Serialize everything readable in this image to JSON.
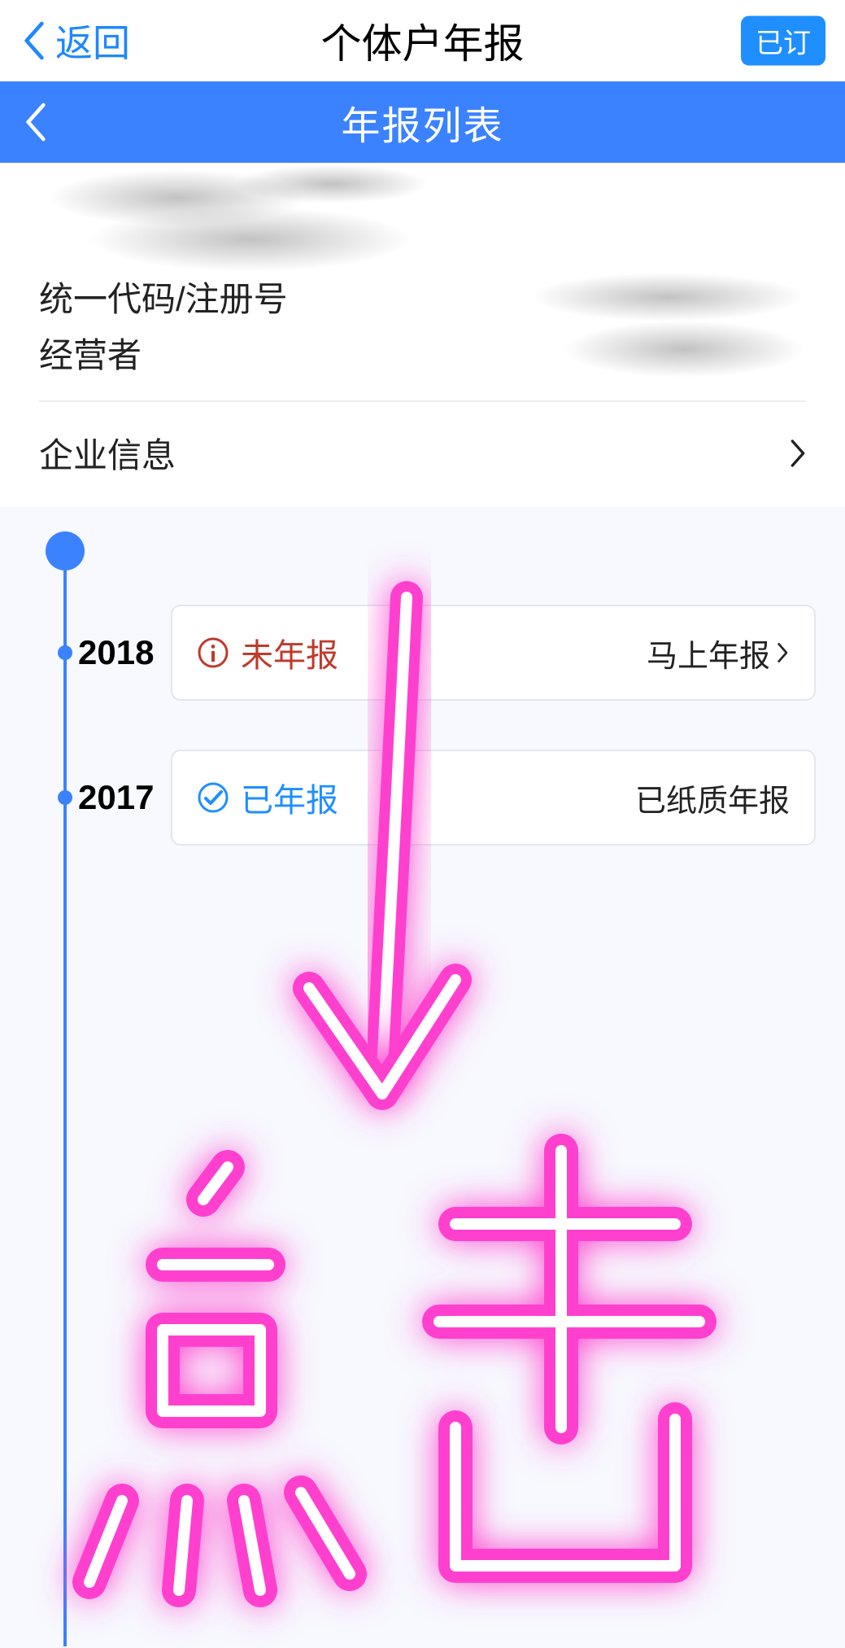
{
  "topbar": {
    "back_label": "返回",
    "title": "个体户年报",
    "badge": "已订"
  },
  "subheader": {
    "title": "年报列表"
  },
  "info": {
    "code_label": "统一代码/注册号",
    "operator_label": "经营者",
    "company_link": "企业信息"
  },
  "timeline": {
    "items": [
      {
        "year": "2018",
        "status_text": "未年报",
        "status_kind": "red",
        "action_text": "马上年报",
        "action_has_chevron": true
      },
      {
        "year": "2017",
        "status_text": "已年报",
        "status_kind": "blue",
        "action_text": "已纸质年报",
        "action_has_chevron": false
      }
    ]
  },
  "annotation": {
    "text": "点击"
  }
}
